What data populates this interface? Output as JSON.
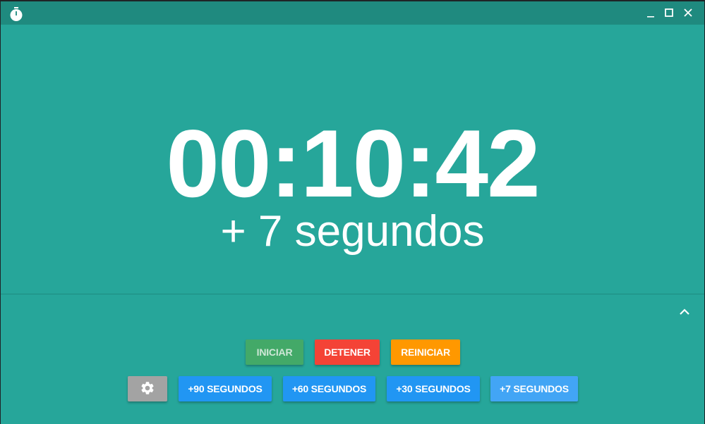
{
  "window": {
    "app_icon": "stopwatch-icon",
    "controls": [
      "minimize-icon",
      "maximize-icon",
      "close-icon"
    ]
  },
  "timer": {
    "display": "00:10:42",
    "increment": "+ 7 segundos"
  },
  "controls": {
    "start_label": "INICIAR",
    "stop_label": "DETENER",
    "reset_label": "REINICIAR",
    "settings_icon": "gear-icon",
    "add_90_label": "+90 SEGUNDOS",
    "add_60_label": "+60 SEGUNDOS",
    "add_30_label": "+30 SEGUNDOS",
    "add_7_label": "+7 SEGUNDOS",
    "collapse_icon": "chevron-up-icon"
  },
  "colors": {
    "background": "#26a69a",
    "titlebar": "#1f8a7f",
    "start": "#43a968",
    "stop": "#f44336",
    "reset": "#ff9800",
    "settings": "#a3a3a3",
    "add_seconds": "#2196f3",
    "add_seconds_active": "#42a5f5"
  }
}
